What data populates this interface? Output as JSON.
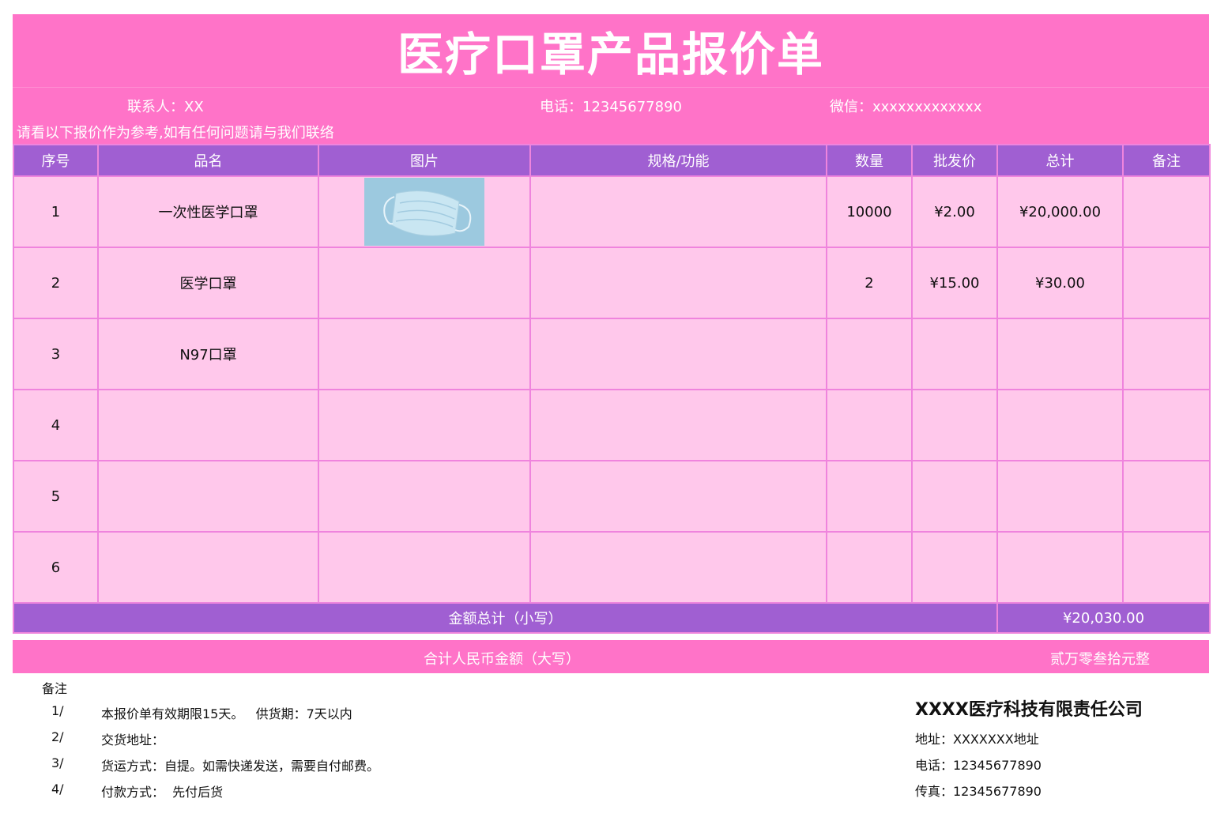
{
  "title": "医疗口罩产品报价单",
  "contact": {
    "person": "联系人：XX",
    "phone": "电话：12345677890",
    "wechat": "微信：xxxxxxxxxxxxx"
  },
  "notice": "请看以下报价作为参考,如有任何问题请与我们联络",
  "table": {
    "headers": [
      "序号",
      "品名",
      "图片",
      "规格/功能",
      "数量",
      "批发价",
      "总计",
      "备注"
    ],
    "rows": [
      {
        "no": "1",
        "name": "一次性医学口罩",
        "spec": "",
        "qty": "10000",
        "price": "¥2.00",
        "total": "¥20,000.00",
        "remark": ""
      },
      {
        "no": "2",
        "name": "医学口罩",
        "spec": "",
        "qty": "2",
        "price": "¥15.00",
        "total": "¥30.00",
        "remark": ""
      },
      {
        "no": "3",
        "name": "N97口罩",
        "spec": "",
        "qty": "",
        "price": "",
        "total": "",
        "remark": ""
      },
      {
        "no": "4",
        "name": "",
        "spec": "",
        "qty": "",
        "price": "",
        "total": "",
        "remark": ""
      },
      {
        "no": "5",
        "name": "",
        "spec": "",
        "qty": "",
        "price": "",
        "total": "",
        "remark": ""
      },
      {
        "no": "6",
        "name": "",
        "spec": "",
        "qty": "",
        "price": "",
        "total": "",
        "remark": ""
      }
    ],
    "total_small_label": "金额总计（小写）",
    "total_small_value": "¥20,030.00",
    "total_upper_label": "合计人民币金额（大写）",
    "total_upper_value": "贰万零叁拾元整"
  },
  "notes": {
    "heading": "备注",
    "items": [
      {
        "idx": "1/",
        "text": "本报价单有效期限15天。   供货期：7天以内"
      },
      {
        "idx": "2/",
        "text": "交货地址："
      },
      {
        "idx": "3/",
        "text": "货运方式：自提。如需快递发送，需要自付邮费。"
      },
      {
        "idx": "4/",
        "text": "付款方式：  先付后货"
      }
    ]
  },
  "company": {
    "name": "XXXX医疗科技有限责任公司",
    "address": "地址：XXXXXXX地址",
    "phone": "电话：12345677890",
    "fax": "传真：12345677890"
  }
}
